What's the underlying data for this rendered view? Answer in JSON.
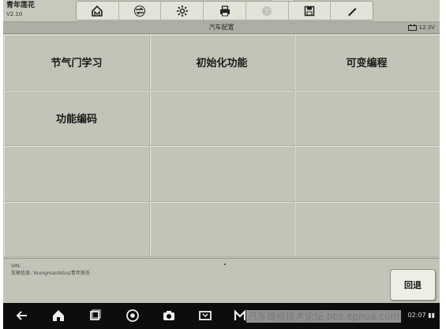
{
  "app": {
    "name": "青年莲花",
    "version": "V2.10"
  },
  "toolbar": {
    "buttons": [
      {
        "icon": "home-icon"
      },
      {
        "icon": "vehicle-swap-icon"
      },
      {
        "icon": "settings-gear-icon"
      },
      {
        "icon": "print-icon"
      },
      {
        "icon": "help-icon"
      },
      {
        "icon": "save-icon"
      },
      {
        "icon": "pen-icon"
      }
    ]
  },
  "header": {
    "title": "汽车配置",
    "battery": "12.3V"
  },
  "functions": [
    {
      "label": "节气门学习"
    },
    {
      "label": "初始化功能"
    },
    {
      "label": "可变编程"
    },
    {
      "label": "功能编码"
    },
    {
      "label": ""
    },
    {
      "label": ""
    },
    {
      "label": ""
    },
    {
      "label": ""
    },
    {
      "label": ""
    },
    {
      "label": ""
    },
    {
      "label": ""
    },
    {
      "label": ""
    }
  ],
  "footer": {
    "vin_label": "VIN:",
    "vehicle_info": "车辆信息: Youngmanlotus/青年莲花",
    "back_label": "回退"
  },
  "navbar": {
    "icons": [
      "back-icon",
      "home-icon",
      "recents-icon",
      "chrome-icon",
      "camera-icon",
      "screenshot-icon",
      "app-icon"
    ],
    "status": "02:07 ▮▮"
  },
  "watermark": "汽车维修技术论坛 bbs.epnua.com"
}
